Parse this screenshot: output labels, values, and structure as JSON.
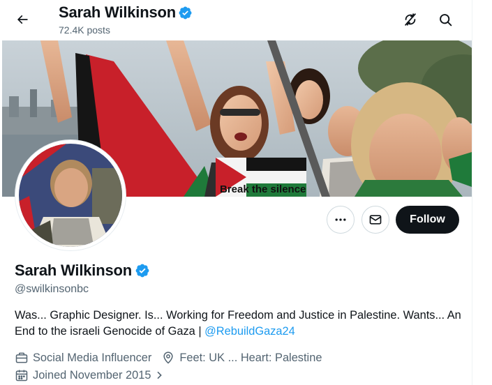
{
  "header": {
    "name": "Sarah Wilkinson",
    "posts": "72.4K posts"
  },
  "banner": {
    "sign_text": "Break the silence"
  },
  "profile": {
    "name": "Sarah Wilkinson",
    "handle": "@swilkinsonbc",
    "bio_text": "Was... Graphic Designer. Is... Working for Freedom and Justice in Palestine. Wants... An End to the israeli Genocide of Gaza | ",
    "bio_link": "@RebuildGaza24",
    "category": "Social Media Influencer",
    "location": "Feet: UK ... Heart: Palestine",
    "joined": "Joined November 2015"
  },
  "actions": {
    "follow_label": "Follow"
  },
  "colors": {
    "accent": "#1d9bf0",
    "follow_bg": "#0f1419",
    "muted_text": "#536471"
  },
  "icons": [
    "back-arrow-icon",
    "verified-badge-icon",
    "no-sync-icon",
    "search-icon",
    "more-icon",
    "mail-icon",
    "briefcase-icon",
    "location-pin-icon",
    "calendar-icon",
    "chevron-right-icon"
  ]
}
